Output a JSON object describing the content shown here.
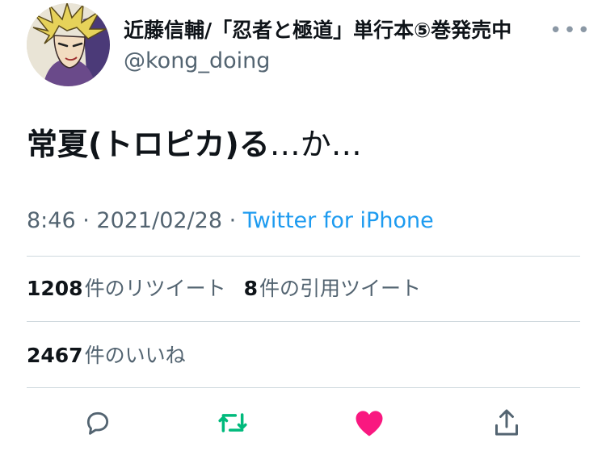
{
  "author": {
    "display_name": "近藤信輔/「忍者と極道」単行本⑤巻発売中",
    "handle": "@kong_doing"
  },
  "header": {
    "more_icon": "more-dots-icon",
    "more_glyph": "•••"
  },
  "tweet": {
    "text_bold": "常夏(トロピカ)る",
    "text_tail": "…か…"
  },
  "meta": {
    "time": "8:46",
    "separator": " · ",
    "date": "2021/02/28",
    "client": "Twitter for iPhone"
  },
  "stats": {
    "retweets_count": "1208",
    "retweets_label": "件のリツイート",
    "quotes_count": "8",
    "quotes_label": "件の引用ツイート",
    "likes_count": "2467",
    "likes_label": "件のいいね"
  },
  "actions": [
    {
      "name": "reply",
      "icon": "reply-bubble-icon",
      "color": "#536471"
    },
    {
      "name": "retweet",
      "icon": "retweet-icon",
      "color": "#00ba7c",
      "active": true
    },
    {
      "name": "like",
      "icon": "heart-icon",
      "color": "#f91880",
      "active": true
    },
    {
      "name": "share",
      "icon": "share-icon",
      "color": "#536471"
    }
  ]
}
